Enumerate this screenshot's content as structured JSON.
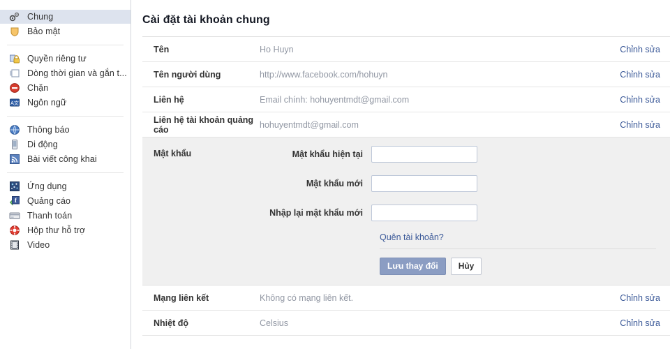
{
  "sidebar": {
    "groups": [
      {
        "items": [
          {
            "label": "Chung",
            "icon": "gears-icon",
            "name": "sidebar-item-chung",
            "selected": true
          },
          {
            "label": "Bảo mật",
            "icon": "shield-icon",
            "name": "sidebar-item-bao-mat",
            "selected": false
          }
        ]
      },
      {
        "items": [
          {
            "label": "Quyền riêng tư",
            "icon": "padlock-icon",
            "name": "sidebar-item-quyen-rieng-tu",
            "selected": false
          },
          {
            "label": "Dòng thời gian và gắn t...",
            "icon": "timeline-icon",
            "name": "sidebar-item-dong-thoi-gian",
            "selected": false
          },
          {
            "label": "Chặn",
            "icon": "block-icon",
            "name": "sidebar-item-chan",
            "selected": false
          },
          {
            "label": "Ngôn ngữ",
            "icon": "language-icon",
            "name": "sidebar-item-ngon-ngu",
            "selected": false
          }
        ]
      },
      {
        "items": [
          {
            "label": "Thông báo",
            "icon": "globe-icon",
            "name": "sidebar-item-thong-bao",
            "selected": false
          },
          {
            "label": "Di động",
            "icon": "mobile-icon",
            "name": "sidebar-item-di-dong",
            "selected": false
          },
          {
            "label": "Bài viết công khai",
            "icon": "rss-icon",
            "name": "sidebar-item-bai-viet-cong-khai",
            "selected": false
          }
        ]
      },
      {
        "items": [
          {
            "label": "Ứng dụng",
            "icon": "apps-icon",
            "name": "sidebar-item-ung-dung",
            "selected": false
          },
          {
            "label": "Quảng cáo",
            "icon": "ads-icon",
            "name": "sidebar-item-quang-cao",
            "selected": false
          },
          {
            "label": "Thanh toán",
            "icon": "creditcard-icon",
            "name": "sidebar-item-thanh-toan",
            "selected": false
          },
          {
            "label": "Hộp thư hỗ trợ",
            "icon": "lifering-icon",
            "name": "sidebar-item-hop-thu-ho-tro",
            "selected": false
          },
          {
            "label": "Video",
            "icon": "film-icon",
            "name": "sidebar-item-video",
            "selected": false
          }
        ]
      }
    ]
  },
  "main": {
    "title": "Cài đặt tài khoản chung",
    "edit_label": "Chỉnh sửa",
    "rows": [
      {
        "label": "Tên",
        "value": "Ho Huyn",
        "name": "row-ten"
      },
      {
        "label": "Tên người dùng",
        "value": "http://www.facebook.com/hohuyn",
        "name": "row-ten-nguoi-dung"
      },
      {
        "label": "Liên hệ",
        "value": "Email chính: hohuyentmdt@gmail.com",
        "name": "row-lien-he"
      },
      {
        "label": "Liên hệ tài khoản quảng cáo",
        "value": "hohuyentmdt@gmail.com",
        "name": "row-lien-he-quang-cao"
      }
    ],
    "password": {
      "section_label": "Mật khẩu",
      "fields": [
        {
          "label": "Mật khẩu hiện tại",
          "value": "",
          "name": "current-password-input"
        },
        {
          "label": "Mật khẩu mới",
          "value": "",
          "name": "new-password-input"
        },
        {
          "label": "Nhập lại mật khẩu mới",
          "value": "",
          "name": "confirm-password-input"
        }
      ],
      "forgot_label": "Quên tài khoản?",
      "save_label": "Lưu thay đổi",
      "cancel_label": "Hủy"
    },
    "rows_bottom": [
      {
        "label": "Mạng liên kết",
        "value": "Không có mạng liên kết.",
        "name": "row-mang-lien-ket"
      },
      {
        "label": "Nhiệt độ",
        "value": "Celsius",
        "name": "row-nhiet-do"
      }
    ]
  },
  "colors": {
    "link": "#3b5998",
    "selected_nav_bg": "#dde3ee",
    "primary_button": "#8b9dc3",
    "section_bg": "#f0f0f0"
  }
}
